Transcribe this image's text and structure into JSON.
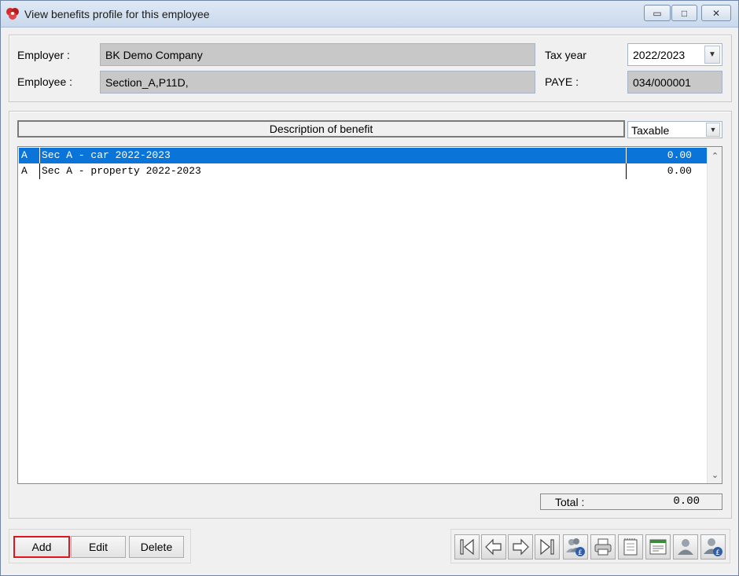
{
  "window": {
    "title": "View benefits profile for this employee",
    "min_glyph": "▭",
    "max_glyph": "□",
    "close_glyph": "✕"
  },
  "header": {
    "employer_label": "Employer :",
    "employer_value": "BK Demo Company",
    "employee_label": "Employee :",
    "employee_value": "Section_A,P11D,",
    "taxyear_label": "Tax year",
    "taxyear_value": "2022/2023",
    "paye_label": "PAYE :",
    "paye_value": "034/000001"
  },
  "list": {
    "column_header": "Description of benefit",
    "amount_column_value": "Taxable",
    "rows": [
      {
        "type": "A",
        "description": "Sec A - car 2022-2023",
        "amount": "0.00",
        "selected": true
      },
      {
        "type": "A",
        "description": "Sec A - property 2022-2023",
        "amount": "0.00",
        "selected": false
      }
    ]
  },
  "total": {
    "label": "Total :",
    "value": "0.00"
  },
  "buttons": {
    "add": "Add",
    "edit": "Edit",
    "delete": "Delete"
  },
  "toolbar": [
    "first-record-icon",
    "previous-record-icon",
    "next-record-icon",
    "last-record-icon",
    "employees-pound-icon",
    "print-icon",
    "notepad-icon",
    "form-icon",
    "person-icon",
    "person-pound-icon"
  ],
  "colors": {
    "selection": "#0a74d9",
    "highlight_border": "#e0151d"
  }
}
